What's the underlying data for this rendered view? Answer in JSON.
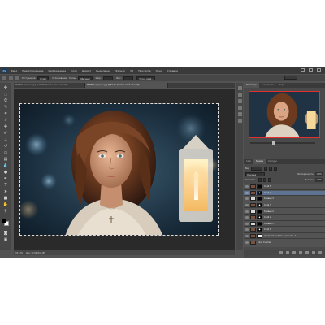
{
  "menu": {
    "logo": "Ps",
    "items": [
      "Файл",
      "Редактирование",
      "Изображение",
      "Слои",
      "Шрифт",
      "Выделение",
      "Фильтр",
      "3D",
      "Просмотр",
      "Окно",
      "Справка"
    ]
  },
  "options": {
    "mode_label": "Растушевка:",
    "feather_value": "0 пикс",
    "antialias_label": "Сглаживание",
    "style_label": "Стиль:",
    "style_value": "Обычный",
    "width_label": "Шир.:",
    "height_label": "Выс.:",
    "refine_button": "Уточн. край..."
  },
  "tabs": [
    {
      "label": "IP25892 девушка.jpg @ 18,8% (Слой 4, Слой-маска/8)",
      "active": false
    },
    {
      "label": "IP25892 девушка.jpg @ 33,3% (Слой 1, Слой-маска/8)",
      "active": true
    }
  ],
  "tools": [
    "move",
    "marquee",
    "lasso",
    "quick-select",
    "crop",
    "eyedropper",
    "healing",
    "brush",
    "clone",
    "history-brush",
    "eraser",
    "gradient",
    "blur",
    "dodge",
    "pen",
    "type",
    "path-select",
    "shape",
    "hand",
    "zoom"
  ],
  "status": {
    "zoom": "33,33%",
    "doc": "Док: 22,9М/243,9М"
  },
  "navigator": {
    "tabs": [
      "Навигатор",
      "Гистограмма",
      "Инфо"
    ],
    "zoom_fraction": 0.35
  },
  "layers_panel": {
    "tabs": [
      "Слои",
      "Каналы",
      "Контуры"
    ],
    "kind_label": "Вид",
    "blend_mode": "Обычные",
    "opacity_label": "Непрозрачность:",
    "opacity_value": "100%",
    "lock_label": "Закрепить:",
    "fill_label": "Заливка:",
    "fill_value": "100%"
  },
  "layers": [
    {
      "name": "Слой 5",
      "selected": false,
      "mask": "black"
    },
    {
      "name": "Слой 4",
      "selected": true,
      "mask": "spot"
    },
    {
      "name": "Кривые 3",
      "selected": false,
      "mask": "black"
    },
    {
      "name": "Слой 3",
      "selected": false,
      "mask": "spot"
    },
    {
      "name": "Кривые 2",
      "selected": false,
      "mask": "black"
    },
    {
      "name": "Слой 2",
      "selected": false,
      "mask": "spot"
    },
    {
      "name": "Кривые 1",
      "selected": false,
      "mask": "black"
    },
    {
      "name": "Слой 1",
      "selected": false,
      "mask": "spot"
    },
    {
      "name": "Цветовой тон/Насыщенность 1",
      "selected": false,
      "mask": "white"
    },
    {
      "name": "Слой 0 копия",
      "selected": false,
      "mask": "none"
    }
  ],
  "colors": {
    "accent_select": "#5d7391",
    "navigator_frame": "#e23030",
    "ps_blue": "#8fc3f0"
  }
}
